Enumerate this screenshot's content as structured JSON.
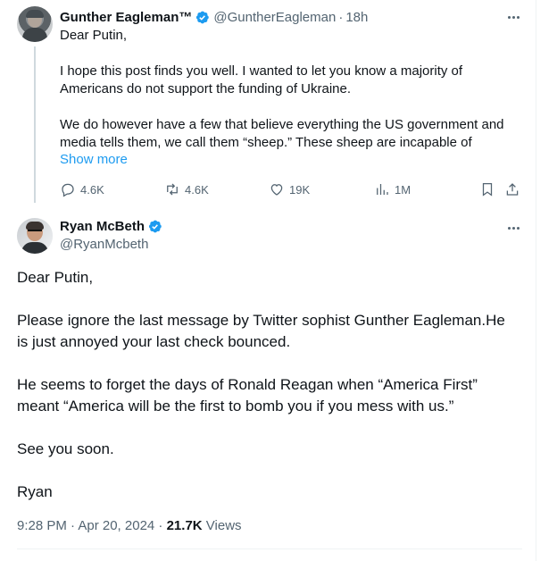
{
  "parent_tweet": {
    "display_name": "Gunther Eagleman™",
    "handle": "@GuntherEagleman",
    "time": "18h",
    "text_lines": [
      "Dear Putin,",
      "I hope this post finds you well.  I wanted to let you know a majority of",
      "Americans do not support the funding of Ukraine.",
      "We do however have a few that believe everything the US government and",
      "media tells them, we call them “sheep.” These sheep are incapable of"
    ],
    "show_more": "Show more",
    "replies": "4.6K",
    "reposts": "4.6K",
    "likes": "19K",
    "views": "1M"
  },
  "main_tweet": {
    "display_name": "Ryan McBeth",
    "handle": "@RyanMcbeth",
    "text_lines": [
      "Dear Putin,",
      "Please ignore the last message by Twitter sophist Gunther Eagleman.He",
      "is just annoyed your last check bounced.",
      "He seems to forget the days of Ronald Reagan when “America First”",
      "meant “America will be the first to bomb you if you mess with us.”",
      "See you soon.",
      "Ryan"
    ],
    "timestamp": "9:28 PM · Apr 20, 2024 · ",
    "views_count": "21.7K",
    "views_label": " Views"
  },
  "colors": {
    "accent": "#1d9bf0",
    "secondary_text": "#536471",
    "primary_text": "#0f1419"
  }
}
